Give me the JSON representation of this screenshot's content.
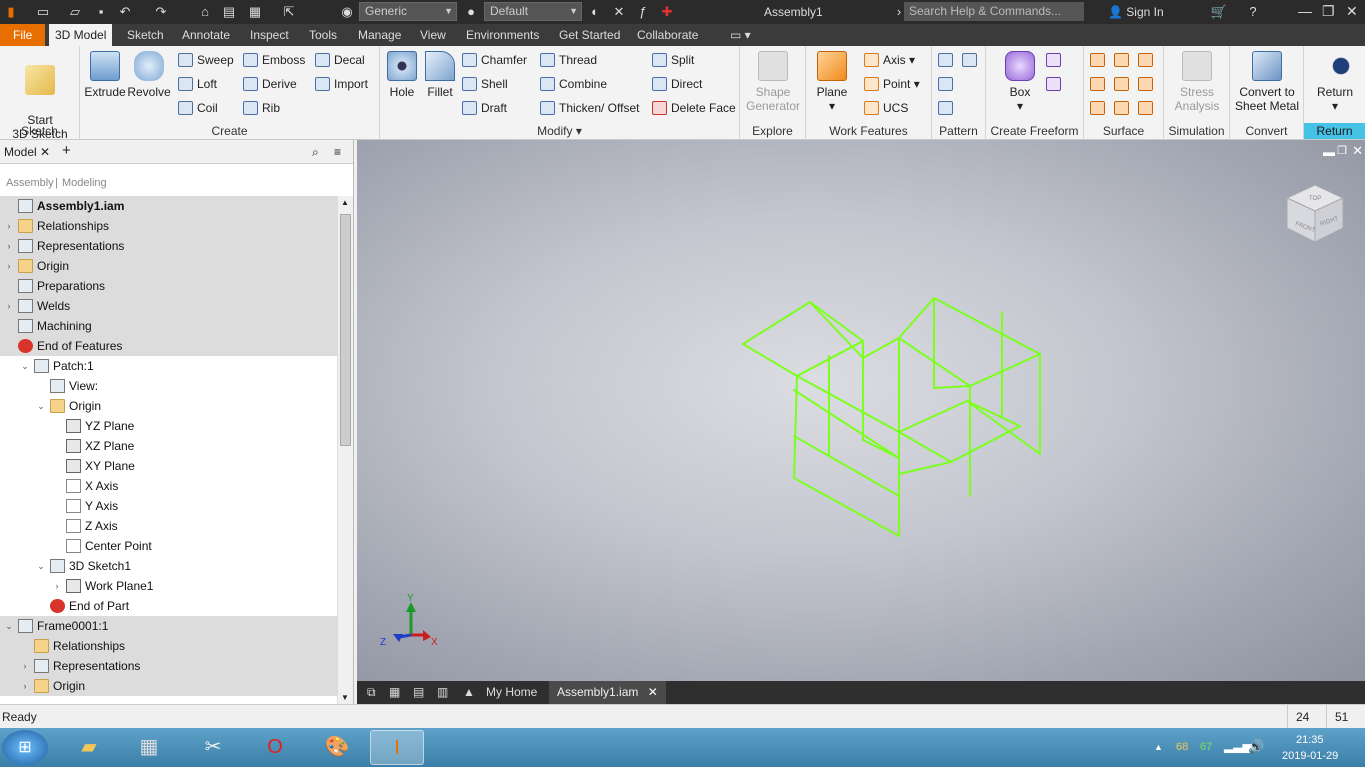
{
  "app_title": "Assembly1",
  "quick_access": {
    "appearance": "Generic",
    "material": "Default",
    "search_placeholder": "Search Help & Commands...",
    "sign_in": "Sign In"
  },
  "menu_tabs": [
    "File",
    "3D Model",
    "Sketch",
    "Annotate",
    "Inspect",
    "Tools",
    "Manage",
    "View",
    "Environments",
    "Get Started",
    "Collaborate"
  ],
  "active_tab": "3D Model",
  "ribbon": {
    "sketch": {
      "start": "Start\n3D Sketch",
      "label": "Sketch"
    },
    "create": {
      "extrude": "Extrude",
      "revolve": "Revolve",
      "sweep": "Sweep",
      "emboss": "Emboss",
      "decal": "Decal",
      "loft": "Loft",
      "derive": "Derive",
      "import": "Import",
      "coil": "Coil",
      "rib": "Rib",
      "label": "Create"
    },
    "modify": {
      "hole": "Hole",
      "fillet": "Fillet",
      "chamfer": "Chamfer",
      "thread": "Thread",
      "split": "Split",
      "shell": "Shell",
      "combine": "Combine",
      "direct": "Direct",
      "draft": "Draft",
      "thicken": "Thicken/ Offset",
      "delete_face": "Delete Face",
      "label": "Modify"
    },
    "explore": {
      "shape_generator": "Shape\nGenerator",
      "label": "Explore"
    },
    "work_features": {
      "plane": "Plane",
      "axis": "Axis",
      "point": "Point",
      "ucs": "UCS",
      "label": "Work Features"
    },
    "pattern": {
      "label": "Pattern"
    },
    "freeform": {
      "box": "Box",
      "label": "Create Freeform"
    },
    "surface": {
      "label": "Surface"
    },
    "simulation": {
      "stress": "Stress\nAnalysis",
      "label": "Simulation"
    },
    "convert": {
      "sheet_metal": "Convert to\nSheet Metal",
      "label": "Convert"
    },
    "return": {
      "return": "Return",
      "label": "Return"
    }
  },
  "browser": {
    "tab": "Model",
    "sub_assembly": "Assembly",
    "sub_modeling": "Modeling",
    "rows": [
      {
        "label": "Assembly1.iam",
        "indent": 0,
        "twisty": "",
        "icon": "gen",
        "bold": true,
        "g": true
      },
      {
        "label": "Relationships",
        "indent": 0,
        "twisty": "›",
        "icon": "folder",
        "g": true
      },
      {
        "label": "Representations",
        "indent": 0,
        "twisty": "›",
        "icon": "gen",
        "g": true
      },
      {
        "label": "Origin",
        "indent": 0,
        "twisty": "›",
        "icon": "folder",
        "g": true
      },
      {
        "label": "Preparations",
        "indent": 0,
        "twisty": "",
        "icon": "gen",
        "g": true
      },
      {
        "label": "Welds",
        "indent": 0,
        "twisty": "›",
        "icon": "gen",
        "g": true
      },
      {
        "label": "Machining",
        "indent": 0,
        "twisty": "",
        "icon": "gen",
        "g": true
      },
      {
        "label": "End of Features",
        "indent": 0,
        "twisty": "",
        "icon": "redx",
        "g": true
      },
      {
        "label": "Patch:1",
        "indent": 1,
        "twisty": "⌄",
        "icon": "gen",
        "g": false
      },
      {
        "label": "View:",
        "indent": 2,
        "twisty": "",
        "icon": "gen",
        "g": false
      },
      {
        "label": "Origin",
        "indent": 2,
        "twisty": "⌄",
        "icon": "folder",
        "g": false
      },
      {
        "label": "YZ Plane",
        "indent": 3,
        "twisty": "",
        "icon": "plane",
        "g": false
      },
      {
        "label": "XZ Plane",
        "indent": 3,
        "twisty": "",
        "icon": "plane",
        "g": false
      },
      {
        "label": "XY Plane",
        "indent": 3,
        "twisty": "",
        "icon": "plane",
        "g": false
      },
      {
        "label": "X Axis",
        "indent": 3,
        "twisty": "",
        "icon": "axis",
        "g": false
      },
      {
        "label": "Y Axis",
        "indent": 3,
        "twisty": "",
        "icon": "axis",
        "g": false
      },
      {
        "label": "Z Axis",
        "indent": 3,
        "twisty": "",
        "icon": "axis",
        "g": false
      },
      {
        "label": "Center Point",
        "indent": 3,
        "twisty": "",
        "icon": "axis",
        "g": false
      },
      {
        "label": "3D Sketch1",
        "indent": 2,
        "twisty": "⌄",
        "icon": "gen",
        "g": false
      },
      {
        "label": "Work Plane1",
        "indent": 3,
        "twisty": "›",
        "icon": "plane",
        "g": false
      },
      {
        "label": "End of Part",
        "indent": 2,
        "twisty": "",
        "icon": "redx",
        "g": false
      },
      {
        "label": "Frame0001:1",
        "indent": 0,
        "twisty": "⌄",
        "icon": "gen",
        "g": true
      },
      {
        "label": "Relationships",
        "indent": 1,
        "twisty": "",
        "icon": "folder",
        "g": true
      },
      {
        "label": "Representations",
        "indent": 1,
        "twisty": "›",
        "icon": "gen",
        "g": true
      },
      {
        "label": "Origin",
        "indent": 1,
        "twisty": "›",
        "icon": "folder",
        "g": true
      }
    ]
  },
  "viewport": {
    "doc_tabs": [
      "My Home",
      "Assembly1.iam"
    ],
    "active_doc": "Assembly1.iam",
    "triad": {
      "x": "X",
      "y": "Y",
      "z": "Z"
    },
    "cube_faces": {
      "front": "FRONT",
      "right": "RIGHT",
      "top": "TOP"
    },
    "wire_color": "#7cff1e"
  },
  "status": {
    "text": "Ready",
    "count1": "24",
    "count2": "51"
  },
  "taskbar": {
    "time": "21:35",
    "date": "2019-01-29",
    "tray_a": "68",
    "tray_b": "67"
  },
  "colors": {
    "file_tab": "#e76f00",
    "return_highlight": "#45c2e6"
  }
}
